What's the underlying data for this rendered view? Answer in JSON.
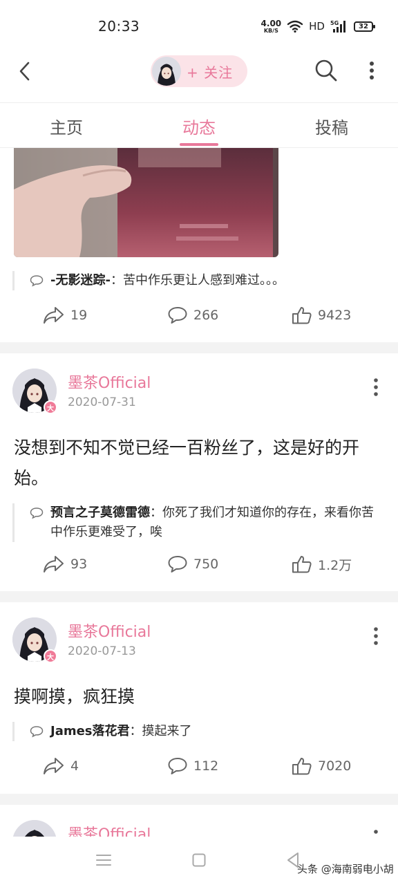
{
  "status_bar": {
    "time": "20:33",
    "net_speed_value": "4.00",
    "net_speed_unit": "KB/S",
    "hd": "HD",
    "network": "5G",
    "battery": "32"
  },
  "header": {
    "follow_label": "+ 关注",
    "icons": [
      "back-icon",
      "avatar",
      "search-icon",
      "more-vertical-icon"
    ]
  },
  "tabs": [
    {
      "label": "主页",
      "active": false
    },
    {
      "label": "动态",
      "active": true
    },
    {
      "label": "投稿",
      "active": false
    }
  ],
  "posts": [
    {
      "comment_user": "-无影迷踪-",
      "comment_text": "：苦中作乐更让人感到难过。。。",
      "shares": "19",
      "comments": "266",
      "likes": "9423"
    },
    {
      "author": "墨茶Official",
      "date": "2020-07-31",
      "text": "没想到不知不觉已经一百粉丝了，这是好的开始。",
      "comment_user": "预言之子莫德雷德",
      "comment_text": "：你死了我们才知道你的存在，来看你苦中作乐更难受了，唉",
      "shares": "93",
      "comments": "750",
      "likes": "1.2万"
    },
    {
      "author": "墨茶Official",
      "date": "2020-07-13",
      "text": "摸啊摸，疯狂摸",
      "comment_user": "James落花君",
      "comment_text": "：摸起来了",
      "shares": "4",
      "comments": "112",
      "likes": "7020"
    },
    {
      "author": "墨茶Official"
    }
  ],
  "avatar_badge": "大",
  "nav": {
    "watermark": "头条 @海南弱电小胡"
  },
  "colors": {
    "accent": "#e8789a",
    "pill_bg": "#fbe3e8",
    "divider": "#f3f3f3"
  }
}
